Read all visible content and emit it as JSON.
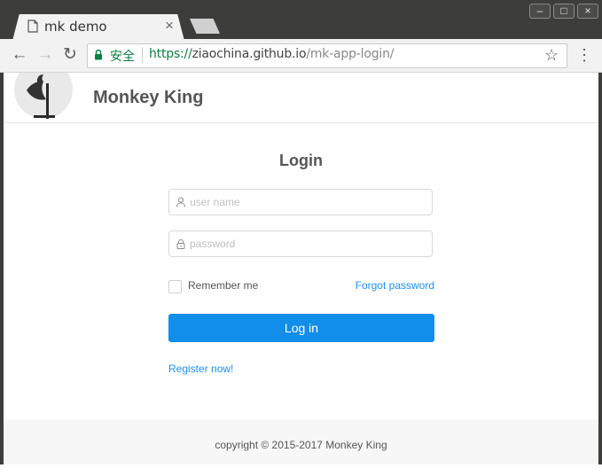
{
  "browser": {
    "tab_title": "mk demo",
    "tab_close": "×",
    "security_label": "安全",
    "url_scheme": "https://",
    "url_host": "ziaochina.github.io",
    "url_path": "/mk-app-login/",
    "star": "☆",
    "menu": "⋮",
    "back": "←",
    "forward": "→",
    "reload": "↻"
  },
  "header": {
    "brand": "Monkey King"
  },
  "login": {
    "title": "Login",
    "username_placeholder": "user name",
    "password_placeholder": "password",
    "remember_label": "Remember me",
    "remember_checked": false,
    "forgot_link": "Forgot password",
    "submit_label": "Log in",
    "register_link": "Register now!"
  },
  "footer": {
    "copyright": "copyright © 2015-2017 Monkey King"
  },
  "colors": {
    "primary": "#108ee9",
    "link": "#1890ff",
    "secure": "#0b8043"
  }
}
